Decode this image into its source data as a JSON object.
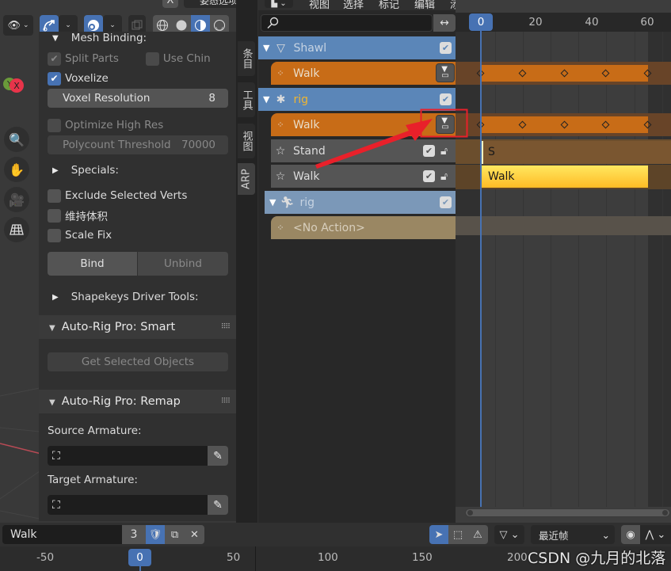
{
  "viewport": {
    "header": {
      "visibility_icon": "eye-icon",
      "gizmo_icon": "transform-gizmo-icon",
      "overlay_icon": "overlay-icon",
      "xray_icon": "xray-icon",
      "shading_modes": [
        "wireframe",
        "solid",
        "material-preview",
        "rendered"
      ],
      "active_shading": "material-preview",
      "top_menu_label": "姿态选项",
      "close_label": "X"
    },
    "axis_gizmo": {
      "y": "Y",
      "x": "X"
    },
    "nav_buttons": [
      "zoom",
      "pan",
      "camera",
      "orthographic-grid"
    ]
  },
  "npanel": {
    "mesh_binding_label": "Mesh Binding:",
    "split_parts": {
      "label": "Split Parts",
      "checked": true,
      "enabled": false
    },
    "use_chin": {
      "label": "Use Chin",
      "checked": false,
      "enabled": false
    },
    "voxelize": {
      "label": "Voxelize",
      "checked": true
    },
    "voxel_resolution": {
      "label": "Voxel Resolution",
      "value": "8"
    },
    "optimize_high_res": {
      "label": "Optimize High Res",
      "checked": false,
      "enabled": false
    },
    "polycount_threshold": {
      "label": "Polycount Threshold",
      "value": "70000"
    },
    "specials_label": "Specials:",
    "exclude_selected_verts": {
      "label": "Exclude Selected Verts",
      "checked": false
    },
    "preserve_volume": {
      "label": "维持体积",
      "checked": false
    },
    "scale_fix": {
      "label": "Scale Fix",
      "checked": false
    },
    "bind_label": "Bind",
    "unbind_label": "Unbind",
    "shapekeys_label": "Shapekeys Driver Tools:",
    "smart_panel": {
      "title": "Auto-Rig Pro: Smart",
      "get_selected_label": "Get Selected Objects"
    },
    "remap_panel": {
      "title": "Auto-Rig Pro: Remap",
      "source_label": "Source Armature:",
      "source_value": "",
      "target_label": "Target Armature:",
      "target_value": ""
    }
  },
  "side_tabs": [
    "条目",
    "工具",
    "视图",
    "ARP"
  ],
  "active_side_tab": "ARP",
  "nla": {
    "menu": [
      "视图",
      "选择",
      "标记",
      "编辑",
      "添加"
    ],
    "snap_label": "最近帧",
    "search": {
      "value": "",
      "placeholder": ""
    },
    "channels": [
      {
        "type": "object",
        "name": "Shawl",
        "icon": "mesh-icon",
        "checked": true
      },
      {
        "type": "action",
        "name": "Walk",
        "icon": "action-icon",
        "pushdown": true
      },
      {
        "type": "object",
        "name": "rig",
        "icon": "armature-icon",
        "checked": true,
        "highlight": true
      },
      {
        "type": "action",
        "name": "Walk",
        "icon": "action-icon",
        "pushdown": true,
        "annotated": true
      },
      {
        "type": "track",
        "name": "Stand",
        "icon": "star-icon",
        "checked": true,
        "locked": false
      },
      {
        "type": "track",
        "name": "Walk",
        "icon": "star-icon",
        "checked": true,
        "locked": false
      },
      {
        "type": "object",
        "name": "rig",
        "icon": "pose-icon",
        "checked": true
      },
      {
        "type": "noaction",
        "name": "<No Action>",
        "icon": "action-icon"
      }
    ],
    "frame_ticks": [
      "0",
      "20",
      "40",
      "60"
    ],
    "current_frame": "0",
    "strips": {
      "stand_label": "S",
      "walk_label": "Walk"
    },
    "keyframes_frames": [
      0,
      15,
      30,
      45,
      60
    ]
  },
  "bottom": {
    "action_name": "Walk",
    "users_count": "3",
    "frame_ticks": [
      "-50",
      "0",
      "50",
      "100",
      "150",
      "200"
    ],
    "current_frame": "0",
    "snap_label": "最近帧",
    "watermark": "CSDN @九月的北落"
  },
  "colors": {
    "accent_blue": "#4772b3",
    "action_orange": "#c86c17",
    "object_blue": "#5b86b8",
    "strip_yellow": "#ffc52e",
    "annotation_red": "#e8202a"
  }
}
